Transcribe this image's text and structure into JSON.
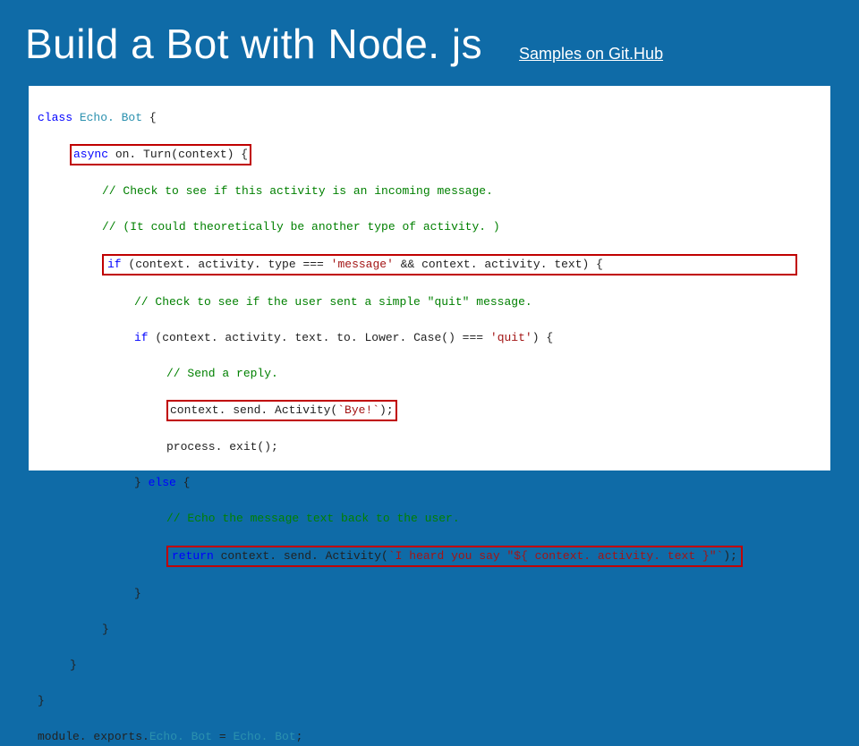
{
  "title": "Build a Bot with Node. js",
  "samples_link": "Samples on Git.Hub",
  "code": {
    "l1_class": "class",
    "l1_name": "Echo. Bot",
    "l2_async": "async",
    "l2_fn": "on. Turn",
    "l2_arg": "context",
    "l3": "// Check to see if this activity is an incoming message.",
    "l4": "// (It could theoretically be another type of activity. )",
    "l5_if": "if",
    "l5_a": "(context. activity. type ===",
    "l5_str": "'message'",
    "l5_b": "&& context. activity. text) {",
    "l6": "// Check to see if the user sent a simple \"quit\" message.",
    "l7_if": "if",
    "l7_a": "(context. activity. text. to. Lower. Case() ===",
    "l7_str": "'quit'",
    "l7_b": ") {",
    "l8": "// Send a reply.",
    "l9_a": "context. send. Activity(",
    "l9_str": "`Bye!`",
    "l9_b": ");",
    "l10": "process. exit();",
    "l11_close": "}",
    "l11_else": "else",
    "l11_open": "{",
    "l12": "// Echo the message text back to the user.",
    "l13_ret": "return",
    "l13_a": "context. send. Activity(",
    "l13_str": "`I heard you say \"${ context. activity. text }\"`",
    "l13_b": ");",
    "l14": "}",
    "l15": "}",
    "l16": "}",
    "l17": "}",
    "l18_a": "module. exports.",
    "l18_b": "Echo. Bot",
    "l18_c": " = ",
    "l18_d": "Echo. Bot",
    "l18_e": ";"
  }
}
